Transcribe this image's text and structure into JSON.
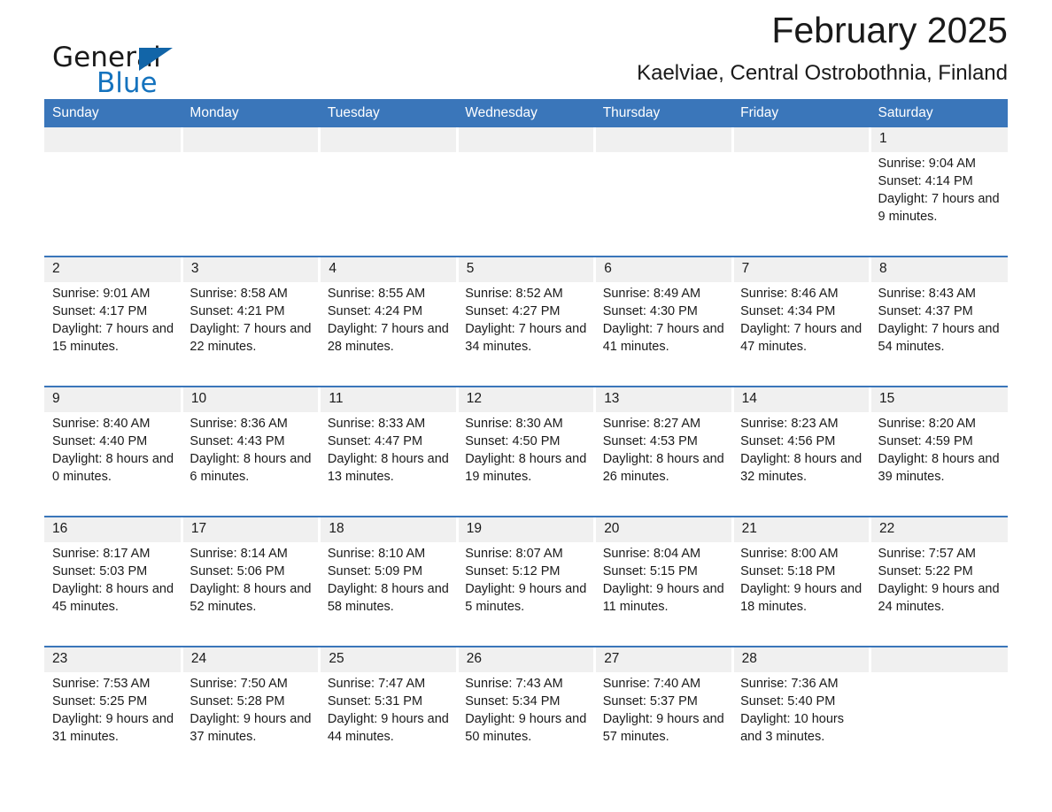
{
  "brand": {
    "name_top": "General",
    "name_bottom": "Blue",
    "flag_icon": "triangle-flag-icon",
    "accent_color": "#1265a8",
    "blue_text_color": "#1573be"
  },
  "header": {
    "title": "February 2025",
    "subtitle": "Kaelviae, Central Ostrobothnia, Finland"
  },
  "theme": {
    "header_blue": "#3a76ba",
    "daynum_bg": "#f0f0f0",
    "text": "#1a1a1a",
    "page_bg": "#ffffff"
  },
  "calendar": {
    "weekday_headers": [
      "Sunday",
      "Monday",
      "Tuesday",
      "Wednesday",
      "Thursday",
      "Friday",
      "Saturday"
    ],
    "weeks": [
      [
        {
          "day": "",
          "sunrise": "",
          "sunset": "",
          "daylight": ""
        },
        {
          "day": "",
          "sunrise": "",
          "sunset": "",
          "daylight": ""
        },
        {
          "day": "",
          "sunrise": "",
          "sunset": "",
          "daylight": ""
        },
        {
          "day": "",
          "sunrise": "",
          "sunset": "",
          "daylight": ""
        },
        {
          "day": "",
          "sunrise": "",
          "sunset": "",
          "daylight": ""
        },
        {
          "day": "",
          "sunrise": "",
          "sunset": "",
          "daylight": ""
        },
        {
          "day": "1",
          "sunrise": "Sunrise: 9:04 AM",
          "sunset": "Sunset: 4:14 PM",
          "daylight": "Daylight: 7 hours and 9 minutes."
        }
      ],
      [
        {
          "day": "2",
          "sunrise": "Sunrise: 9:01 AM",
          "sunset": "Sunset: 4:17 PM",
          "daylight": "Daylight: 7 hours and 15 minutes."
        },
        {
          "day": "3",
          "sunrise": "Sunrise: 8:58 AM",
          "sunset": "Sunset: 4:21 PM",
          "daylight": "Daylight: 7 hours and 22 minutes."
        },
        {
          "day": "4",
          "sunrise": "Sunrise: 8:55 AM",
          "sunset": "Sunset: 4:24 PM",
          "daylight": "Daylight: 7 hours and 28 minutes."
        },
        {
          "day": "5",
          "sunrise": "Sunrise: 8:52 AM",
          "sunset": "Sunset: 4:27 PM",
          "daylight": "Daylight: 7 hours and 34 minutes."
        },
        {
          "day": "6",
          "sunrise": "Sunrise: 8:49 AM",
          "sunset": "Sunset: 4:30 PM",
          "daylight": "Daylight: 7 hours and 41 minutes."
        },
        {
          "day": "7",
          "sunrise": "Sunrise: 8:46 AM",
          "sunset": "Sunset: 4:34 PM",
          "daylight": "Daylight: 7 hours and 47 minutes."
        },
        {
          "day": "8",
          "sunrise": "Sunrise: 8:43 AM",
          "sunset": "Sunset: 4:37 PM",
          "daylight": "Daylight: 7 hours and 54 minutes."
        }
      ],
      [
        {
          "day": "9",
          "sunrise": "Sunrise: 8:40 AM",
          "sunset": "Sunset: 4:40 PM",
          "daylight": "Daylight: 8 hours and 0 minutes."
        },
        {
          "day": "10",
          "sunrise": "Sunrise: 8:36 AM",
          "sunset": "Sunset: 4:43 PM",
          "daylight": "Daylight: 8 hours and 6 minutes."
        },
        {
          "day": "11",
          "sunrise": "Sunrise: 8:33 AM",
          "sunset": "Sunset: 4:47 PM",
          "daylight": "Daylight: 8 hours and 13 minutes."
        },
        {
          "day": "12",
          "sunrise": "Sunrise: 8:30 AM",
          "sunset": "Sunset: 4:50 PM",
          "daylight": "Daylight: 8 hours and 19 minutes."
        },
        {
          "day": "13",
          "sunrise": "Sunrise: 8:27 AM",
          "sunset": "Sunset: 4:53 PM",
          "daylight": "Daylight: 8 hours and 26 minutes."
        },
        {
          "day": "14",
          "sunrise": "Sunrise: 8:23 AM",
          "sunset": "Sunset: 4:56 PM",
          "daylight": "Daylight: 8 hours and 32 minutes."
        },
        {
          "day": "15",
          "sunrise": "Sunrise: 8:20 AM",
          "sunset": "Sunset: 4:59 PM",
          "daylight": "Daylight: 8 hours and 39 minutes."
        }
      ],
      [
        {
          "day": "16",
          "sunrise": "Sunrise: 8:17 AM",
          "sunset": "Sunset: 5:03 PM",
          "daylight": "Daylight: 8 hours and 45 minutes."
        },
        {
          "day": "17",
          "sunrise": "Sunrise: 8:14 AM",
          "sunset": "Sunset: 5:06 PM",
          "daylight": "Daylight: 8 hours and 52 minutes."
        },
        {
          "day": "18",
          "sunrise": "Sunrise: 8:10 AM",
          "sunset": "Sunset: 5:09 PM",
          "daylight": "Daylight: 8 hours and 58 minutes."
        },
        {
          "day": "19",
          "sunrise": "Sunrise: 8:07 AM",
          "sunset": "Sunset: 5:12 PM",
          "daylight": "Daylight: 9 hours and 5 minutes."
        },
        {
          "day": "20",
          "sunrise": "Sunrise: 8:04 AM",
          "sunset": "Sunset: 5:15 PM",
          "daylight": "Daylight: 9 hours and 11 minutes."
        },
        {
          "day": "21",
          "sunrise": "Sunrise: 8:00 AM",
          "sunset": "Sunset: 5:18 PM",
          "daylight": "Daylight: 9 hours and 18 minutes."
        },
        {
          "day": "22",
          "sunrise": "Sunrise: 7:57 AM",
          "sunset": "Sunset: 5:22 PM",
          "daylight": "Daylight: 9 hours and 24 minutes."
        }
      ],
      [
        {
          "day": "23",
          "sunrise": "Sunrise: 7:53 AM",
          "sunset": "Sunset: 5:25 PM",
          "daylight": "Daylight: 9 hours and 31 minutes."
        },
        {
          "day": "24",
          "sunrise": "Sunrise: 7:50 AM",
          "sunset": "Sunset: 5:28 PM",
          "daylight": "Daylight: 9 hours and 37 minutes."
        },
        {
          "day": "25",
          "sunrise": "Sunrise: 7:47 AM",
          "sunset": "Sunset: 5:31 PM",
          "daylight": "Daylight: 9 hours and 44 minutes."
        },
        {
          "day": "26",
          "sunrise": "Sunrise: 7:43 AM",
          "sunset": "Sunset: 5:34 PM",
          "daylight": "Daylight: 9 hours and 50 minutes."
        },
        {
          "day": "27",
          "sunrise": "Sunrise: 7:40 AM",
          "sunset": "Sunset: 5:37 PM",
          "daylight": "Daylight: 9 hours and 57 minutes."
        },
        {
          "day": "28",
          "sunrise": "Sunrise: 7:36 AM",
          "sunset": "Sunset: 5:40 PM",
          "daylight": "Daylight: 10 hours and 3 minutes."
        },
        {
          "day": "",
          "sunrise": "",
          "sunset": "",
          "daylight": ""
        }
      ]
    ]
  }
}
